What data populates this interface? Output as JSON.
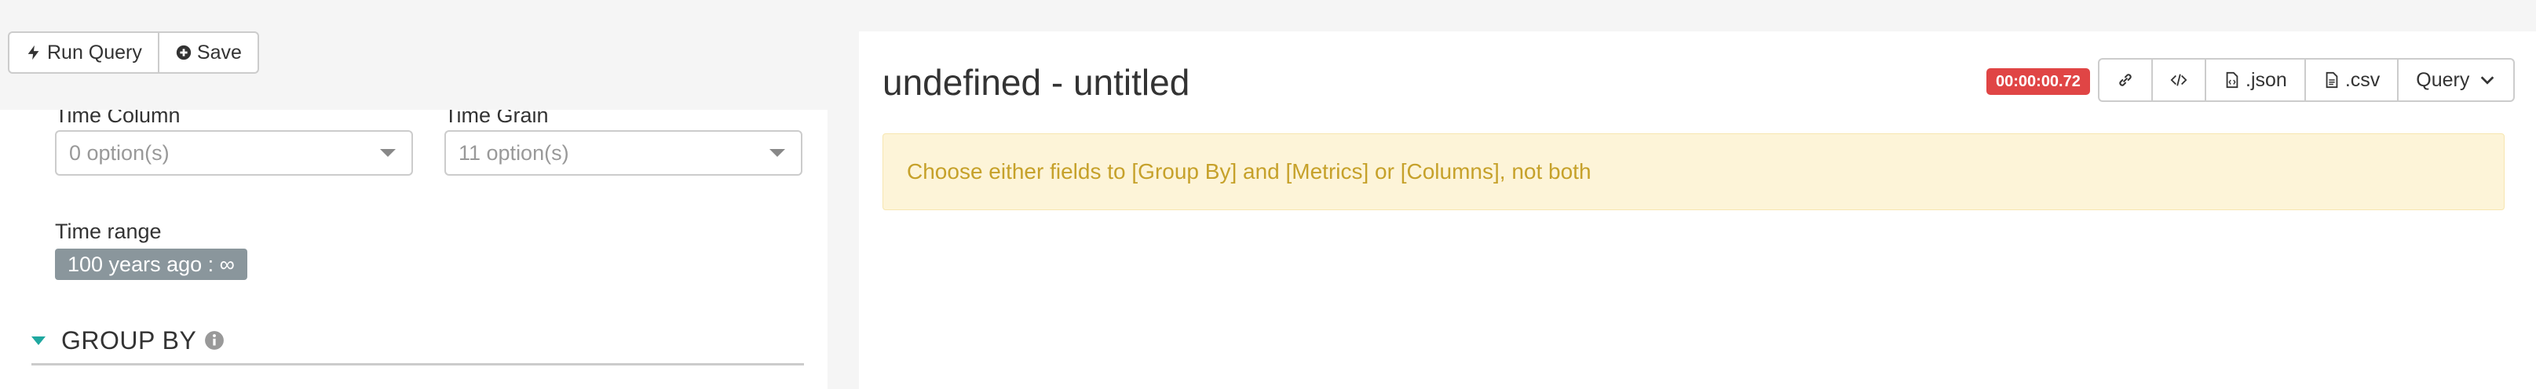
{
  "toolbar_left": {
    "run_query_label": "Run Query",
    "save_label": "Save"
  },
  "controls": {
    "time_column": {
      "label": "Time Column",
      "placeholder": "0 option(s)"
    },
    "time_grain": {
      "label": "Time Grain",
      "placeholder": "11 option(s)"
    },
    "time_range": {
      "label": "Time range",
      "value": "100 years ago : ∞"
    },
    "group_by": {
      "title": "GROUP BY"
    }
  },
  "chart": {
    "title": "undefined - untitled",
    "timer": "00:00:00.72",
    "actions": {
      "json_label": ".json",
      "csv_label": ".csv",
      "query_label": "Query"
    },
    "alert_message": "Choose either fields to [Group By] and [Metrics] or [Columns], not both"
  },
  "colors": {
    "timer_bg": "#e04545",
    "alert_bg": "#fdf4d8",
    "alert_text": "#c6a12a",
    "group_caret": "#1fa8a0",
    "badge_bg": "#8a969c"
  },
  "icons": [
    "bolt-icon",
    "plus-circle-icon",
    "link-icon",
    "code-icon",
    "file-code-icon",
    "file-text-icon",
    "chevron-down-icon",
    "info-icon"
  ]
}
